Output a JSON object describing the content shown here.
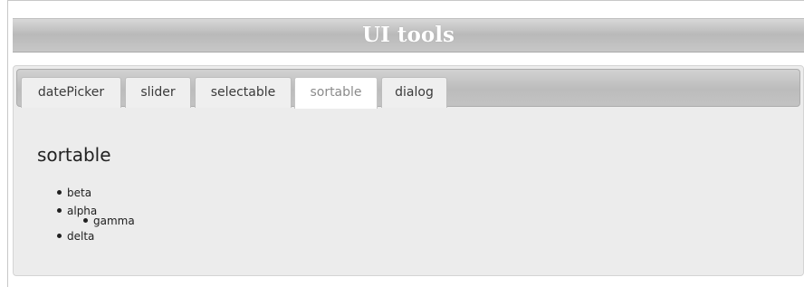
{
  "header": {
    "title": "UI tools"
  },
  "tabs": [
    {
      "label": "datePicker",
      "active": false
    },
    {
      "label": "slider",
      "active": false
    },
    {
      "label": "selectable",
      "active": false
    },
    {
      "label": "sortable",
      "active": true
    },
    {
      "label": "dialog",
      "active": false
    }
  ],
  "panel": {
    "title": "sortable",
    "items": [
      {
        "label": "beta"
      },
      {
        "label": "alpha"
      },
      {
        "label": "gamma",
        "state": "dragging"
      },
      {
        "label": "delta"
      }
    ]
  },
  "colors": {
    "header_gradient_top": "#d8d8d8",
    "header_gradient_bottom": "#b9b9b9",
    "panel_background": "#ececec",
    "active_tab_background": "#ffffff"
  }
}
